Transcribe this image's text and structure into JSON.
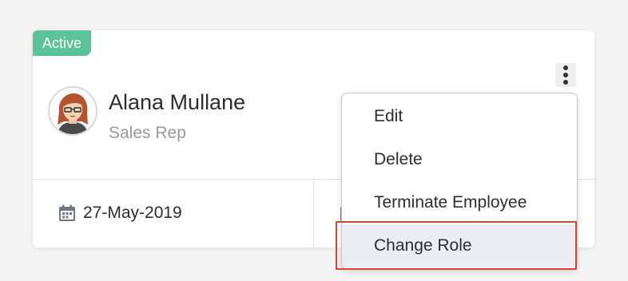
{
  "card": {
    "status": "Active",
    "employee_name": "Alana Mullane",
    "employee_role": "Sales Rep",
    "date": "27-May-2019"
  },
  "menu": {
    "items": [
      {
        "label": "Edit"
      },
      {
        "label": "Delete"
      },
      {
        "label": "Terminate Employee"
      },
      {
        "label": "Change Role"
      }
    ],
    "highlighted_index": 3
  },
  "icons": {
    "more": "kebab-menu-icon",
    "date": "calendar-icon"
  },
  "colors": {
    "status_green": "#5cc29b",
    "focus_red": "#d9452e",
    "menu_highlight": "#ecedf3"
  }
}
